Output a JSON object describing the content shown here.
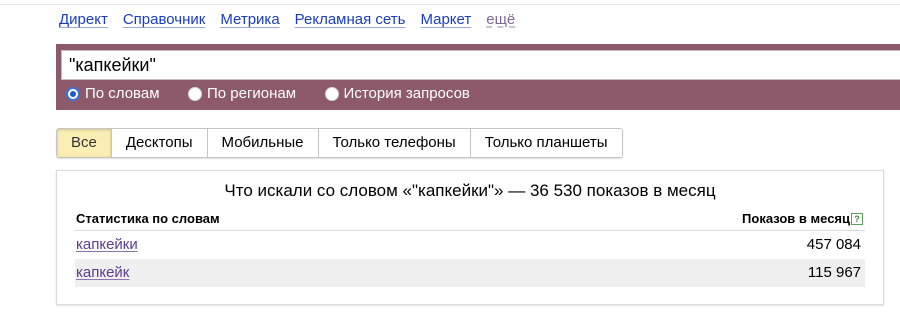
{
  "topnav": {
    "items": [
      "Директ",
      "Справочник",
      "Метрика",
      "Рекламная сеть",
      "Маркет"
    ],
    "more": "ещё"
  },
  "search": {
    "query": "\"капкейки\"",
    "radios": [
      {
        "label": "По словам",
        "checked": true
      },
      {
        "label": "По регионам",
        "checked": false
      },
      {
        "label": "История запросов",
        "checked": false
      }
    ],
    "band_color": "#8d5a6c"
  },
  "tabs": [
    {
      "label": "Все",
      "active": true
    },
    {
      "label": "Десктопы",
      "active": false
    },
    {
      "label": "Мобильные",
      "active": false
    },
    {
      "label": "Только телефоны",
      "active": false
    },
    {
      "label": "Только планшеты",
      "active": false
    }
  ],
  "results": {
    "title": "Что искали со словом «\"капкейки\"» — 36 530 показов в месяц",
    "col_words": "Статистика по словам",
    "col_impressions": "Показов в месяц",
    "help_glyph": "?",
    "rows": [
      {
        "keyword": "капкейки",
        "count": "457 084"
      },
      {
        "keyword": "капкейк",
        "count": "115 967"
      }
    ]
  }
}
